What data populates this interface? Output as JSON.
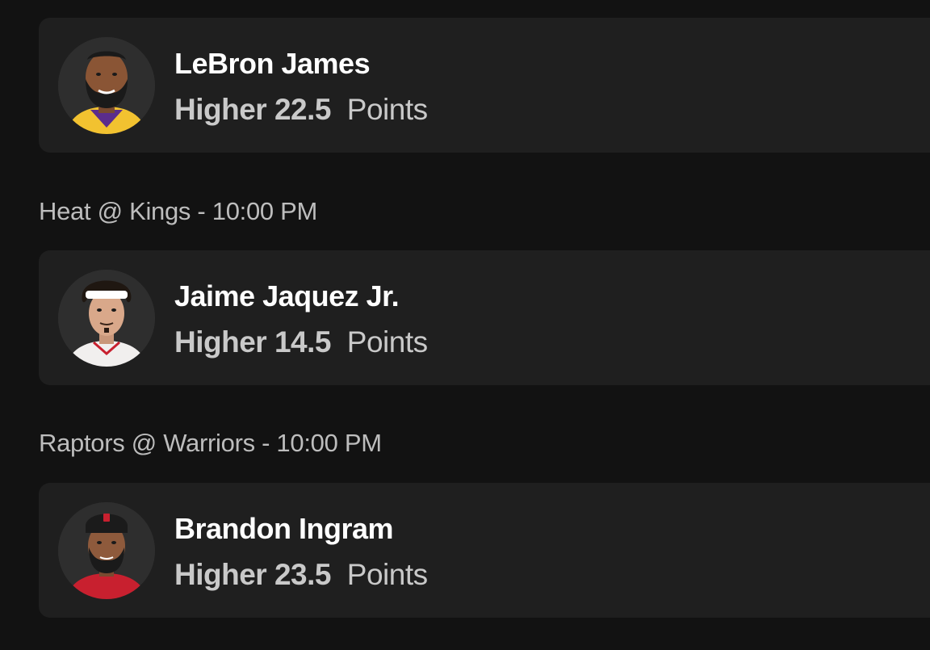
{
  "colors": {
    "background": "#121212",
    "card": "#1f1f1f",
    "name_text": "#ffffff",
    "pick_text": "#c9c9c9",
    "header_text": "#bdbdbd"
  },
  "games": [
    {
      "header": "",
      "player": {
        "name": "LeBron James",
        "avatar_icon": "player-headshot-icon",
        "jersey_color": "#f2c230",
        "pick": {
          "direction": "Higher",
          "line": "22.5",
          "stat": "Points"
        }
      }
    },
    {
      "header": "Heat @ Kings - 10:00 PM",
      "player": {
        "name": "Jaime Jaquez Jr.",
        "avatar_icon": "player-headshot-icon",
        "jersey_color": "#f1efee",
        "pick": {
          "direction": "Higher",
          "line": "14.5",
          "stat": "Points"
        }
      }
    },
    {
      "header": "Raptors @ Warriors - 10:00 PM",
      "player": {
        "name": "Brandon Ingram",
        "avatar_icon": "player-headshot-icon",
        "jersey_color": "#c8202f",
        "pick": {
          "direction": "Higher",
          "line": "23.5",
          "stat": "Points"
        }
      }
    }
  ]
}
